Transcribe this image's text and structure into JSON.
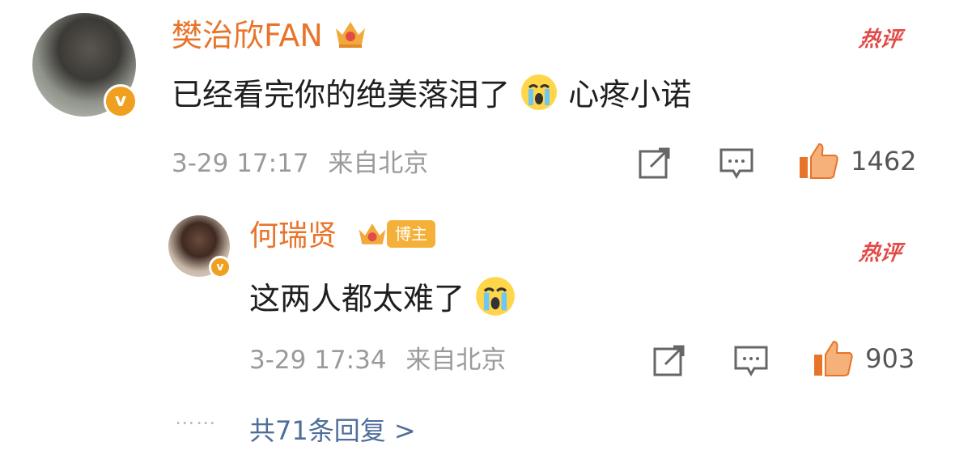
{
  "comment": {
    "username": "樊治欣FAN",
    "text": "已经看完你的绝美落泪了",
    "text_after_emoji": "心疼小诺",
    "date": "3-29 17:17",
    "location": "来自北京",
    "likes": "1462",
    "hot_label": "热评",
    "verify_mark": "v"
  },
  "reply": {
    "username": "何瑞贤",
    "badge": "博主",
    "text": "这两人都太难了",
    "date": "3-29 17:34",
    "location": "来自北京",
    "likes": "903",
    "hot_label": "热评",
    "verify_mark": "v"
  },
  "more_replies": {
    "label": "共71条回复 >",
    "dots": "⋯⋯"
  },
  "colors": {
    "username": "#e8742a",
    "hot": "#e24b47",
    "meta": "#9a9a9a",
    "link": "#4f6e9a"
  }
}
